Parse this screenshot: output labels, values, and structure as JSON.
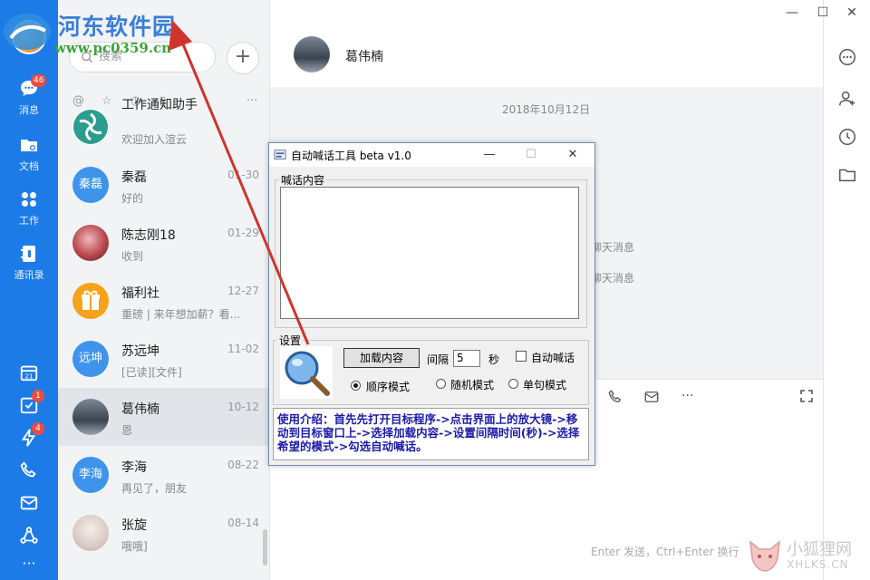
{
  "nav": {
    "items": [
      {
        "label": "消息",
        "badge": "46"
      },
      {
        "label": "文档"
      },
      {
        "label": "工作"
      },
      {
        "label": "通讯录"
      }
    ],
    "bottom_badges": [
      "1",
      "4"
    ]
  },
  "search": {
    "placeholder": "搜索"
  },
  "conversations": [
    {
      "name": "工作通知助手",
      "message": "欢迎加入渲云",
      "time": "",
      "avatar_text": ""
    },
    {
      "name": "秦磊",
      "message": "好的",
      "time": "01-30",
      "avatar_text": "秦磊"
    },
    {
      "name": "陈志刚18",
      "message": "收到",
      "time": "01-29",
      "avatar_text": ""
    },
    {
      "name": "福利社",
      "message": "重磅 | 来年想加薪？看...",
      "time": "12-27",
      "avatar_text": ""
    },
    {
      "name": "苏远坤",
      "message": "[已读][文件]",
      "time": "11-02",
      "avatar_text": "远坤"
    },
    {
      "name": "葛伟楠",
      "message": "恩",
      "time": "10-12",
      "avatar_text": ""
    },
    {
      "name": "李海",
      "message": "再见了，朋友",
      "time": "08-22",
      "avatar_text": "李海"
    },
    {
      "name": "张旋",
      "message": "哦哦]",
      "time": "08-14",
      "avatar_text": ""
    }
  ],
  "chat": {
    "title": "葛伟楠",
    "date": "2018年10月12日",
    "system_messages": [
      "聊天消息",
      "聊天消息"
    ],
    "hint": "Enter 发送，Ctrl+Enter 换行"
  },
  "dialog": {
    "title": "自动喊话工具 beta v1.0",
    "content_group": "喊话内容",
    "settings_group": "设置",
    "load_button": "加载内容",
    "interval_label": "间隔",
    "interval_value": "5",
    "seconds_label": "秒",
    "auto_label": "自动喊话",
    "mode_sequential": "顺序模式",
    "mode_random": "随机模式",
    "mode_single": "单句模式",
    "usage": "使用介绍：首先先打开目标程序->点击界面上的放大镜->移动到目标窗口上->选择加载内容->设置间隔时间(秒)->选择希望的模式->勾选自动喊话。"
  },
  "watermark": {
    "brand": "河东软件园",
    "url": "www.pc0359.cn",
    "bottom_cn": "小狐狸网",
    "bottom_en": "XHLKS.CN"
  },
  "colors": {
    "nav_blue": "#1d7be8",
    "badge_red": "#f04a3e",
    "usage_text": "#1a1aa8"
  }
}
